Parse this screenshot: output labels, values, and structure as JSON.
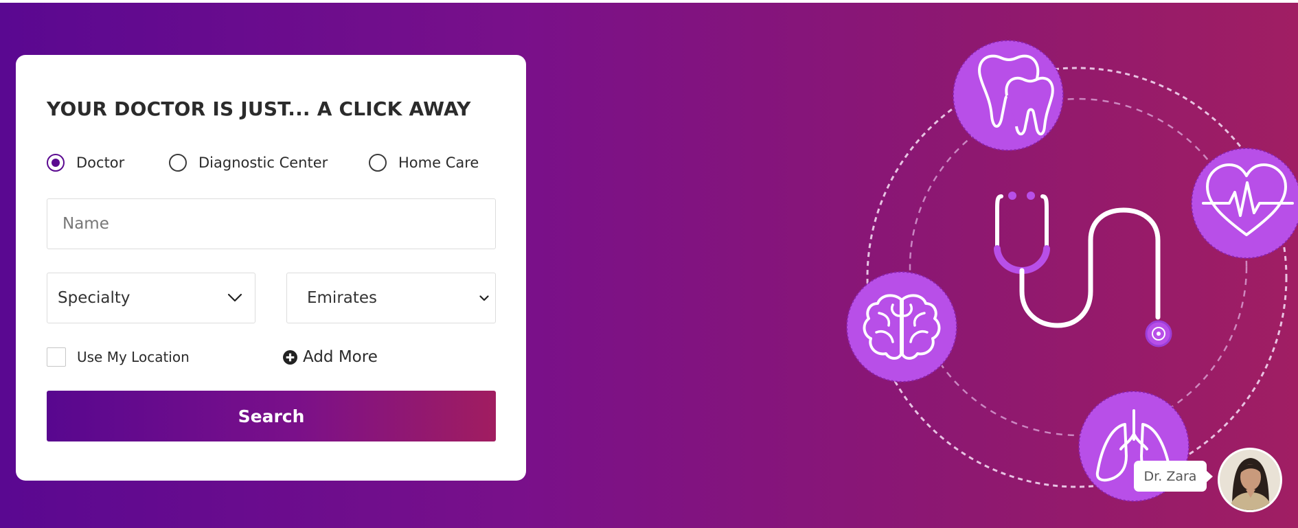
{
  "search_card": {
    "title": "YOUR DOCTOR IS JUST... A CLICK AWAY",
    "options": [
      {
        "label": "Doctor",
        "selected": true
      },
      {
        "label": "Diagnostic Center",
        "selected": false
      },
      {
        "label": "Home Care",
        "selected": false
      }
    ],
    "name_placeholder": "Name",
    "specialty_select": {
      "value": "Specialty",
      "icon": "chevron-down-icon"
    },
    "emirates_select": {
      "value": "Emirates",
      "icon": "chevron-down-icon"
    },
    "use_location": {
      "label": "Use My Location",
      "checked": false
    },
    "add_more": {
      "label": "Add More",
      "icon": "plus-circle-icon"
    },
    "search_button": "Search"
  },
  "illustration": {
    "icons": [
      "tooth-icon",
      "heart-pulse-icon",
      "brain-icon",
      "lungs-icon",
      "stethoscope-icon"
    ]
  },
  "chat_assistant": {
    "name": "Dr. Zara",
    "avatar": "avatar"
  },
  "colors": {
    "primary_purple": "#5b0a90",
    "gradient_end": "#a01e63",
    "icon_circle": "#b94fe8",
    "card_background": "#ffffff"
  }
}
